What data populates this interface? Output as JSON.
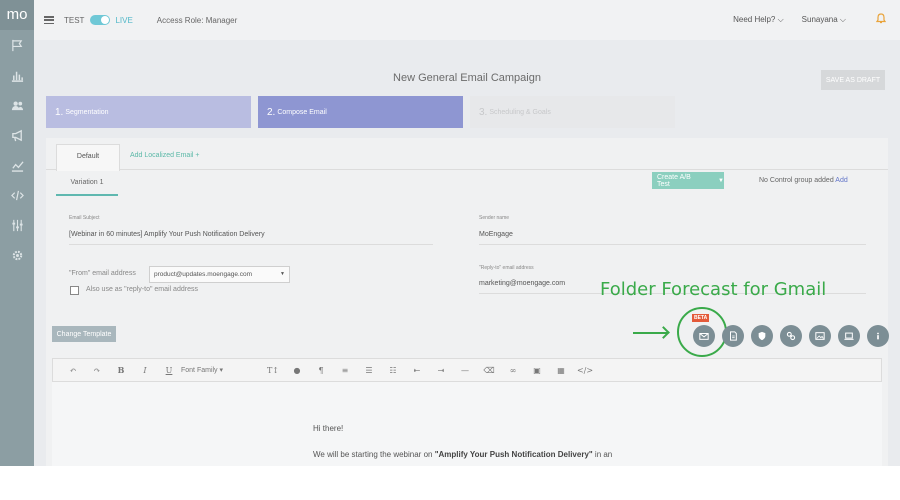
{
  "app": {
    "logo": "mo",
    "env_test": "TEST",
    "env_live": "LIVE",
    "access_role": "Access Role: Manager",
    "help": "Need Help? ⌵",
    "user": "Sunayana ⌵"
  },
  "sidebar": {
    "items": [
      "flag-icon",
      "bar-chart-icon",
      "users-icon",
      "megaphone-icon",
      "line-chart-icon",
      "code-icon",
      "sliders-icon",
      "settings-icon"
    ]
  },
  "campaign": {
    "title": "New General Email Campaign",
    "save_label": "SAVE AS DRAFT"
  },
  "steps": [
    {
      "num": "1.",
      "label": "Segmentation"
    },
    {
      "num": "2.",
      "label": "Compose Email"
    },
    {
      "num": "3.",
      "label": "Scheduling & Goals"
    }
  ],
  "tabs": {
    "default": "Default",
    "add_localized": "Add Localized Email +"
  },
  "variation": {
    "label": "Variation 1",
    "ab_label": "Create A/B Test",
    "control_note": "No Control group added",
    "control_add": "Add"
  },
  "form": {
    "subject_label": "Email Subject",
    "subject_value": "[Webinar in 60 minutes] Amplify Your Push Notification Delivery",
    "sender_label": "Sender name",
    "sender_value": "MoEngage",
    "from_label": "\"From\" email address",
    "from_value": "product@updates.moengage.com",
    "reply_checkbox_label": "Also use as \"reply-to\" email address",
    "reply_label": "\"Reply-to\" email address",
    "reply_value": "marketing@moengage.com"
  },
  "template": {
    "change_label": "Change Template"
  },
  "annotation": {
    "title": "Folder Forecast for Gmail",
    "beta": "BETA"
  },
  "editor": {
    "font_family": "Font Family",
    "greeting": "Hi there!",
    "body_prefix": "We will be starting the webinar on ",
    "body_bold": "\"Amplify Your Push Notification Delivery\"",
    "body_suffix": " in an"
  },
  "colors": {
    "sidebar": "#8c9ea3",
    "accent_teal": "#5ab8a7",
    "step_active": "#8e96d2",
    "annotation_green": "#3aaa4a",
    "beta_red": "#e45a3a"
  }
}
